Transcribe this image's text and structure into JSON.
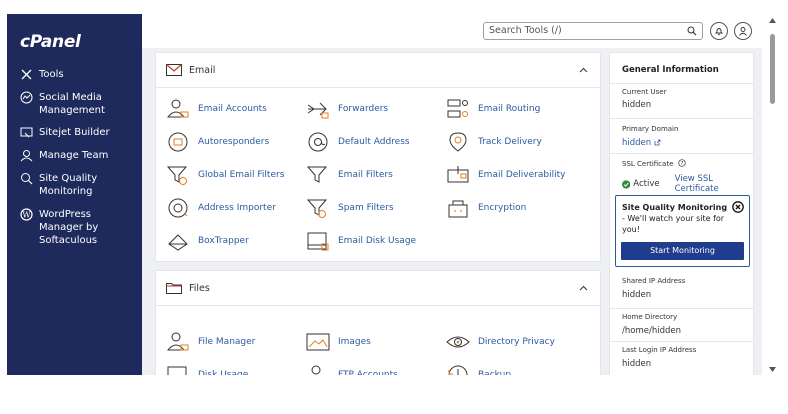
{
  "brand": {
    "logo_text": "cPanel"
  },
  "sidebar": {
    "items": [
      {
        "label": "Tools",
        "icon": "tools-icon"
      },
      {
        "label": "Social Media\nManagement",
        "icon": "social-icon"
      },
      {
        "label": "Sitejet Builder",
        "icon": "sitejet-icon"
      },
      {
        "label": "Manage Team",
        "icon": "team-icon"
      },
      {
        "label": "Site Quality\nMonitoring",
        "icon": "site-quality-icon"
      },
      {
        "label": "WordPress\nManager by\nSoftaculous",
        "icon": "wordpress-icon"
      }
    ]
  },
  "header": {
    "search_placeholder": "Search Tools (/)"
  },
  "email_panel": {
    "title": "Email",
    "tools": [
      {
        "label": "Email Accounts",
        "icon": "email-accounts-icon"
      },
      {
        "label": "Forwarders",
        "icon": "forwarders-icon"
      },
      {
        "label": "Email Routing",
        "icon": "email-routing-icon"
      },
      {
        "label": "Autoresponders",
        "icon": "autoresponders-icon"
      },
      {
        "label": "Default Address",
        "icon": "default-address-icon"
      },
      {
        "label": "Track Delivery",
        "icon": "track-delivery-icon"
      },
      {
        "label": "Global Email Filters",
        "icon": "global-filters-icon"
      },
      {
        "label": "Email Filters",
        "icon": "email-filters-icon"
      },
      {
        "label": "Email Deliverability",
        "icon": "email-deliverability-icon"
      },
      {
        "label": "Address Importer",
        "icon": "address-importer-icon"
      },
      {
        "label": "Spam Filters",
        "icon": "spam-filters-icon"
      },
      {
        "label": "Encryption",
        "icon": "encryption-icon"
      },
      {
        "label": "BoxTrapper",
        "icon": "boxtrapper-icon"
      },
      {
        "label": "Email Disk Usage",
        "icon": "email-disk-usage-icon"
      }
    ]
  },
  "files_panel": {
    "title": "Files",
    "tools": [
      {
        "label": "File Manager",
        "icon": "file-manager-icon"
      },
      {
        "label": "Images",
        "icon": "images-icon"
      },
      {
        "label": "Directory Privacy",
        "icon": "directory-privacy-icon"
      },
      {
        "label": "Disk Usage",
        "icon": "disk-usage-icon"
      },
      {
        "label": "FTP Accounts",
        "icon": "ftp-accounts-icon"
      },
      {
        "label": "Backup",
        "icon": "backup-icon"
      }
    ]
  },
  "general_info": {
    "title": "General Information",
    "current_user_label": "Current User",
    "current_user_value": "hidden",
    "primary_domain_label": "Primary Domain",
    "primary_domain_value": "hidden",
    "ssl_label": "SSL Certificate",
    "ssl_status": "Active",
    "ssl_link": "View SSL Certificate",
    "shared_ip_label": "Shared IP Address",
    "shared_ip_value": "hidden",
    "home_dir_label": "Home Directory",
    "home_dir_value": "/home/hidden",
    "last_login_label": "Last Login IP Address",
    "last_login_value": "hidden"
  },
  "promo": {
    "title": "Site Quality Monitoring",
    "text": " - We'll watch your site for you!",
    "button": "Start Monitoring"
  },
  "colors": {
    "sidebar_bg": "#1f2a5c",
    "link": "#2c5aa0",
    "button": "#1f3d8c",
    "active_green": "#2e8b3a"
  }
}
